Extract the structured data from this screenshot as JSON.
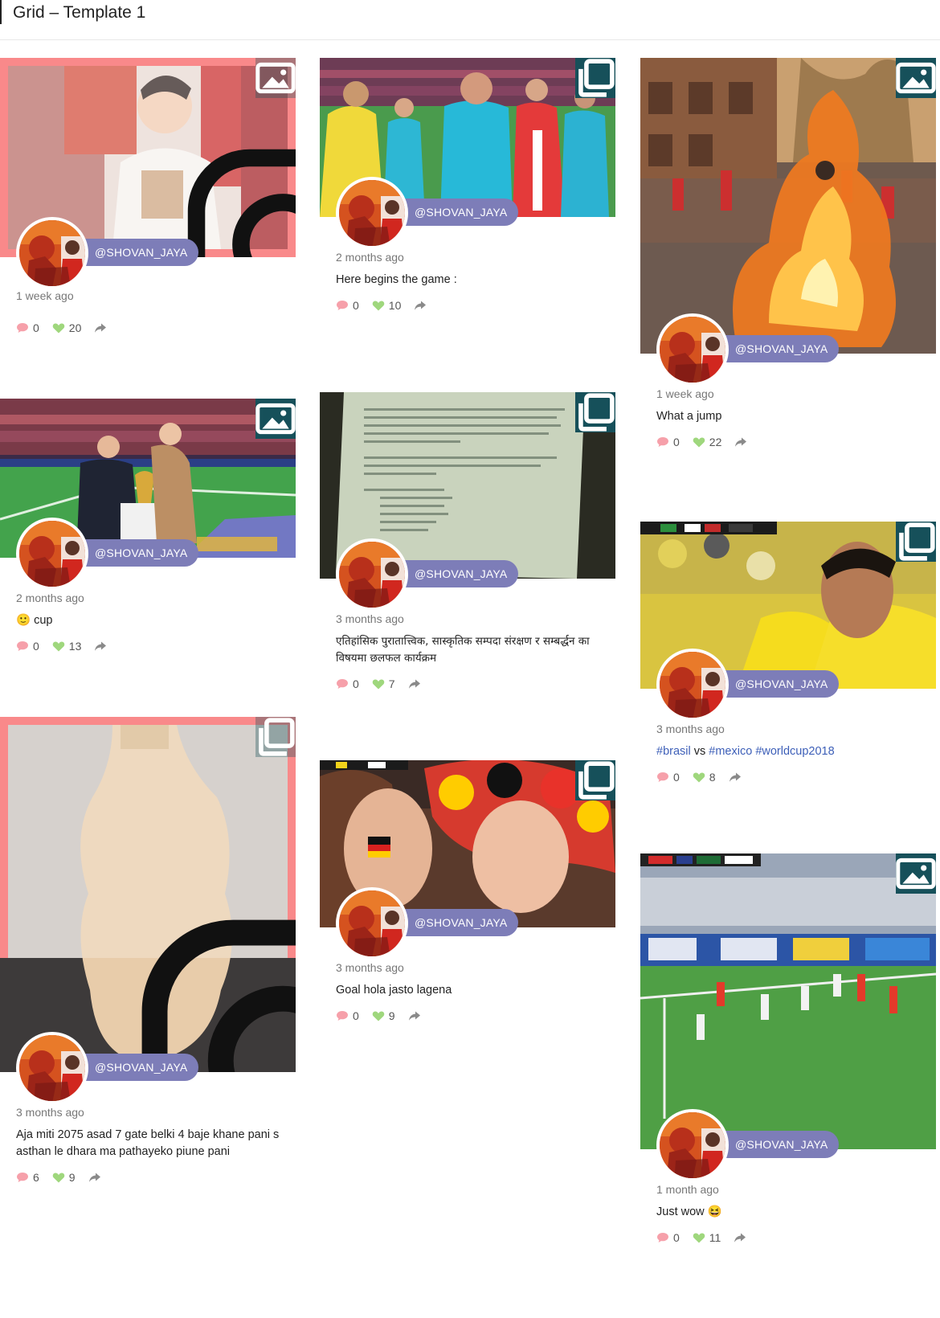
{
  "header": {
    "title": "Grid – Template 1"
  },
  "colors": {
    "pill": "#7d7db8",
    "badge": "#16505a",
    "comment": "#ef6f7e",
    "like": "#8fd16b",
    "instagram_overlay": "#f9898a",
    "hashtag": "#3d5fb8"
  },
  "posts": [
    {
      "user": "@SHOVAN_JAYA",
      "time": "1 week ago",
      "caption": "",
      "comments": "0",
      "likes": "20",
      "media_type": "image-icon",
      "hover_icon": "instagram-icon"
    },
    {
      "user": "@SHOVAN_JAYA",
      "time": "2 months ago",
      "caption": "Here begins the game :",
      "comments": "0",
      "likes": "10",
      "media_type": "carousel-icon"
    },
    {
      "user": "@SHOVAN_JAYA",
      "time": "1 week ago",
      "caption": "What a jump",
      "comments": "0",
      "likes": "22",
      "media_type": "image-icon"
    },
    {
      "user": "@SHOVAN_JAYA",
      "time": "2 months ago",
      "caption": "cup",
      "caption_emoji": "🙂",
      "comments": "0",
      "likes": "13",
      "media_type": "image-icon"
    },
    {
      "user": "@SHOVAN_JAYA",
      "time": "3 months ago",
      "caption": "एतिहांसिक पुरातात्त्विक, सास्कृतिक सम्पदा संरक्षण र सम्बर्द्धन का विषयमा छलफल कार्यक्रम",
      "comments": "0",
      "likes": "7",
      "media_type": "carousel-icon"
    },
    {
      "user": "@SHOVAN_JAYA",
      "time": "3 months ago",
      "caption_parts": [
        "#brasil",
        " vs ",
        "#mexico",
        " ",
        "#worldcup2018"
      ],
      "comments": "0",
      "likes": "8",
      "media_type": "carousel-icon"
    },
    {
      "user": "@SHOVAN_JAYA",
      "time": "3 months ago",
      "caption": "Aja miti 2075 asad 7 gate belki 4 baje khane pani s asthan le dhara ma pathayeko piune pani",
      "comments": "6",
      "likes": "9",
      "media_type": "carousel-icon",
      "hover_icon": "instagram-icon"
    },
    {
      "user": "@SHOVAN_JAYA",
      "time": "3 months ago",
      "caption": "Goal hola jasto lagena",
      "comments": "0",
      "likes": "9",
      "media_type": "carousel-icon"
    },
    {
      "user": "@SHOVAN_JAYA",
      "time": "1 month ago",
      "caption": "Just wow",
      "caption_emoji": "😆",
      "comments": "0",
      "likes": "11",
      "media_type": "image-icon"
    }
  ]
}
